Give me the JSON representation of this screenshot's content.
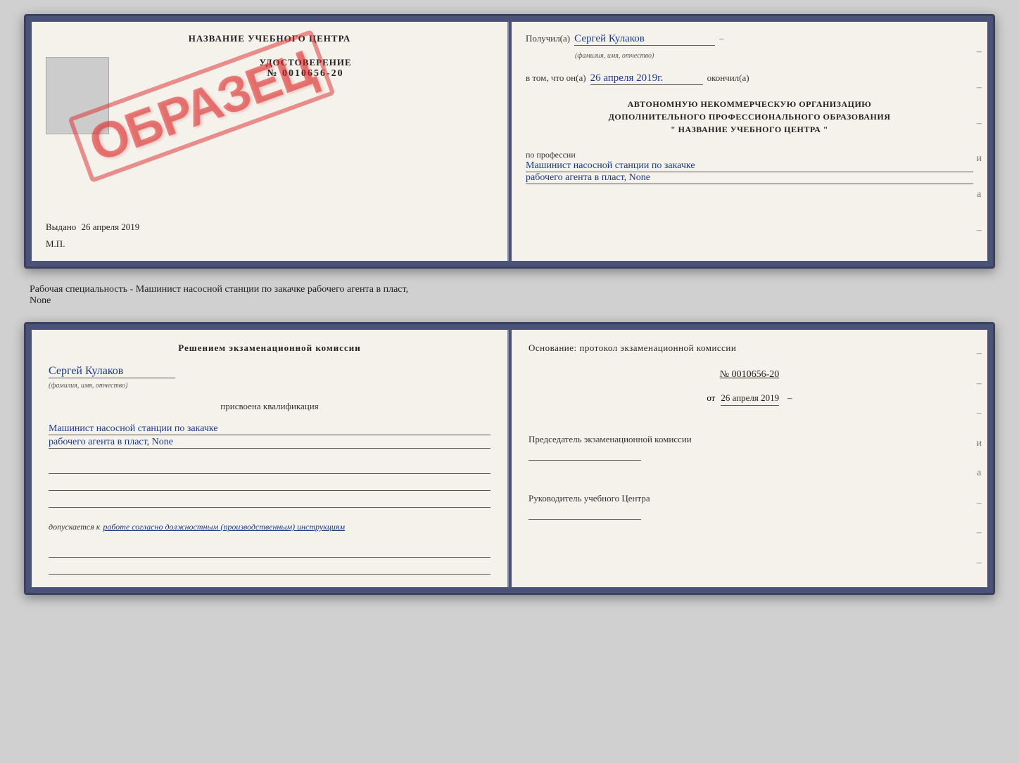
{
  "top_cert": {
    "left": {
      "title": "НАЗВАНИЕ УЧЕБНОГО ЦЕНТРА",
      "doc_label": "УДОСТОВЕРЕНИЕ",
      "doc_number": "№ 0010656-20",
      "issued_label": "Выдано",
      "issued_date": "26 апреля 2019",
      "mp_label": "М.П.",
      "obrazec": "ОБРАЗЕЦ"
    },
    "right": {
      "received_label": "Получил(а)",
      "received_name": "Сергей Кулаков",
      "name_hint": "(фамилия, имя, отчество)",
      "completed_prefix": "в том, что он(а)",
      "completed_date": "26 апреля 2019г.",
      "completed_suffix": "окончил(а)",
      "org_line1": "АВТОНОМНУЮ НЕКОММЕРЧЕСКУЮ ОРГАНИЗАЦИЮ",
      "org_line2": "ДОПОЛНИТЕЛЬНОГО ПРОФЕССИОНАЛЬНОГО ОБРАЗОВАНИЯ",
      "org_line3": "\"  НАЗВАНИЕ УЧЕБНОГО ЦЕНТРА  \"",
      "profession_label": "по профессии",
      "profession_line1": "Машинист насосной станции по закачке",
      "profession_line2": "рабочего агента в пласт, None",
      "dashes": [
        "-",
        "-",
        "-",
        "и",
        "а",
        "-"
      ]
    }
  },
  "middle_text": "Рабочая специальность - Машинист насосной станции по закачке рабочего агента в пласт,",
  "middle_text2": "None",
  "bottom_cert": {
    "left": {
      "commission_title": "Решением экзаменационной комиссии",
      "person_name": "Сергей Кулаков",
      "name_hint": "(фамилия, имя, отчество)",
      "qualification_label": "присвоена квалификация",
      "qual_line1": "Машинист насосной станции по закачке",
      "qual_line2": "рабочего агента в пласт, None",
      "blank_lines": [
        "",
        "",
        ""
      ],
      "allowed_label": "допускается к",
      "allowed_text": "работе согласно должностным (производственным) инструкциям",
      "bottom_lines": [
        "",
        ""
      ]
    },
    "right": {
      "basis_title": "Основание: протокол экзаменационной комиссии",
      "protocol_number": "№ 0010656-20",
      "protocol_date_prefix": "от",
      "protocol_date": "26 апреля 2019",
      "commission_head_label": "Председатель экзаменационной комиссии",
      "center_head_label": "Руководитель учебного Центра",
      "dashes": [
        "-",
        "-",
        "-",
        "и",
        "а",
        "-",
        "-",
        "-"
      ]
    }
  }
}
